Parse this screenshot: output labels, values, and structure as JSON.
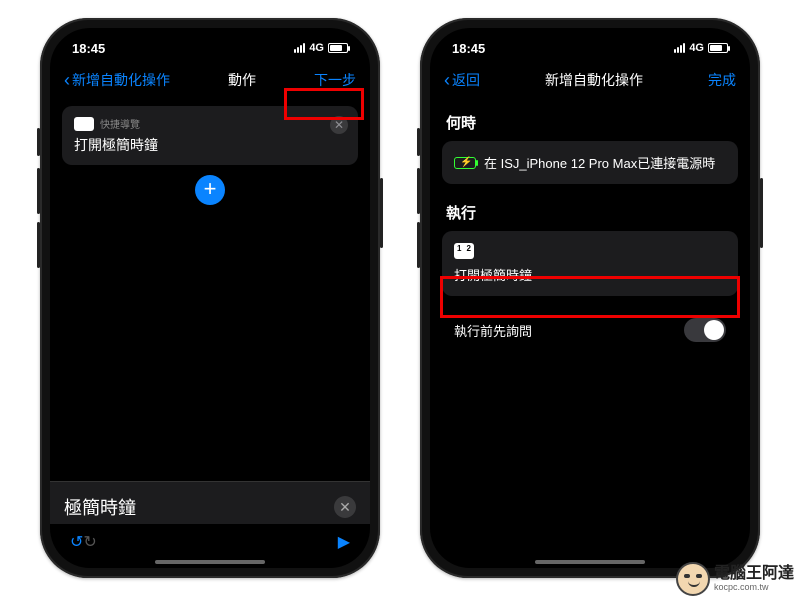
{
  "status": {
    "time": "18:45",
    "network": "4G"
  },
  "left": {
    "nav": {
      "back": "新增自動化操作",
      "title": "動作",
      "next": "下一步"
    },
    "card": {
      "sub": "快捷導覽",
      "title": "打開極簡時鐘"
    },
    "sheet": {
      "title": "極簡時鐘"
    }
  },
  "right": {
    "nav": {
      "back": "返回",
      "title": "新增自動化操作",
      "done": "完成"
    },
    "when": {
      "header": "何時",
      "text": "在 ISJ_iPhone 12 Pro Max已連接電源時"
    },
    "run": {
      "header": "執行",
      "text": "打開極簡時鐘"
    },
    "toggle": {
      "label": "執行前先詢問"
    }
  },
  "watermark": {
    "name": "電腦王阿達",
    "url": "kocpc.com.tw"
  }
}
